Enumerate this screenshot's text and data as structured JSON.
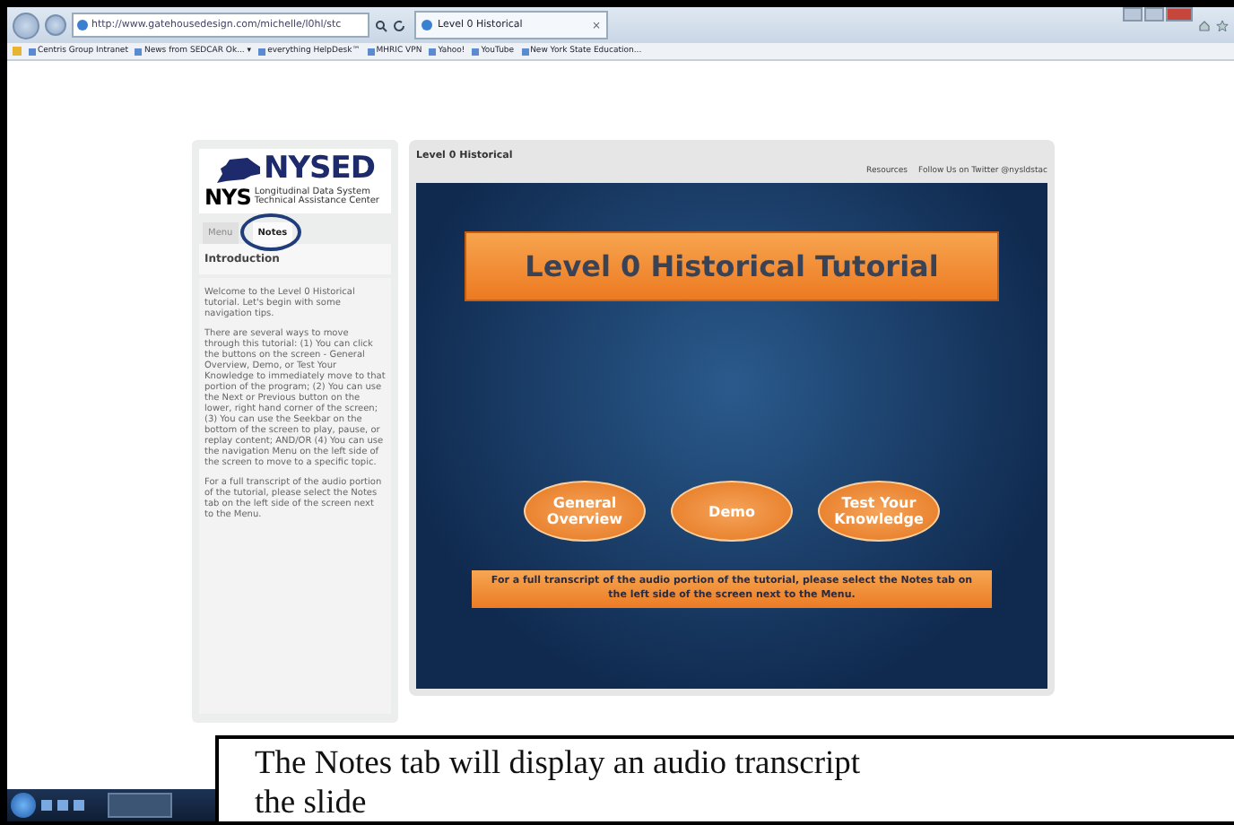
{
  "browser": {
    "address": "http://www.gatehousedesign.com/michelle/l0hl/stc",
    "tab_title": "Level 0 Historical",
    "tab_close": "×",
    "favorites": [
      "Centris Group Intranet",
      "News from SEDCAR Ok... ▾",
      "everything HelpDesk™",
      "MHRIC VPN",
      "Yahoo!",
      "YouTube",
      "New York State Education..."
    ]
  },
  "logo": {
    "title": "NYSED",
    "prefix": "NYS",
    "line_1": "Longitudinal Data System",
    "line_2": "Technical Assistance Center"
  },
  "sidebar": {
    "tabs": [
      {
        "label": "Menu",
        "selected": false
      },
      {
        "label": "Notes",
        "selected": true
      }
    ],
    "heading": "Introduction",
    "paragraphs": [
      "Welcome to the Level 0 Historical tutorial. Let's begin with some navigation tips.",
      "There are several ways to move through this tutorial: (1) You can click the buttons on the screen - General Overview, Demo, or Test Your Knowledge to immediately move to that portion of the program; (2) You can use the Next or Previous button on the lower, right hand corner of the screen; (3) You can use the Seekbar on the bottom of the screen to play, pause, or replay content; AND/OR (4) You can use the navigation Menu on the left side of the screen to move to a specific topic.",
      "For a full transcript of the audio portion of the tutorial, please select the Notes tab on the left side of the screen next to the Menu."
    ]
  },
  "main": {
    "title": "Level 0 Historical",
    "links": [
      "Resources",
      "Follow Us on Twitter @nysldstac"
    ],
    "slide_title": "Level 0 Historical Tutorial",
    "buttons": [
      "General Overview",
      "Demo",
      "Test Your Knowledge"
    ],
    "note": "For a full transcript of the audio portion of the tutorial, please select the Notes tab on the left side of the screen next to the Menu."
  },
  "caption": {
    "lines": [
      "The Notes tab will display an audio transcript",
      "the slide"
    ]
  }
}
